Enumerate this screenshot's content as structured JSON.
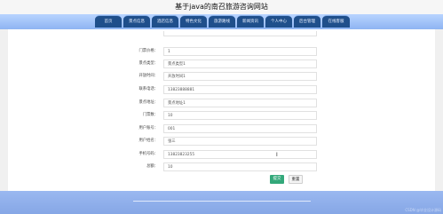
{
  "header": {
    "site_title": "基于java的南召旅游咨询网站"
  },
  "nav": {
    "items": [
      {
        "label": "首页"
      },
      {
        "label": "景点信息"
      },
      {
        "label": "酒店信息"
      },
      {
        "label": "特色文化"
      },
      {
        "label": "旅游路线"
      },
      {
        "label": "新闻资讯"
      },
      {
        "label": "个人中心"
      },
      {
        "label": "后台管理"
      },
      {
        "label": "在线客服"
      }
    ]
  },
  "form": {
    "fields": [
      {
        "label": "门票价格：",
        "value": "1"
      },
      {
        "label": "景点类型：",
        "value": "景点类型1"
      },
      {
        "label": "开放时间：",
        "value": "开放时间1"
      },
      {
        "label": "联系电话：",
        "value": "13823888881"
      },
      {
        "label": "景点地址：",
        "value": "景点地址1"
      },
      {
        "label": "门票数：",
        "value": "10"
      },
      {
        "label": "用户账号：",
        "value": "001"
      },
      {
        "label": "用户姓名：",
        "value": "张三"
      },
      {
        "label": "手机号码：",
        "value": "13823823255"
      },
      {
        "label": "总额：",
        "value": "10"
      }
    ],
    "submit_label": "提交",
    "reset_label": "重置"
  },
  "footer": {
    "watermark": "CSDN @毕业设计源码"
  }
}
